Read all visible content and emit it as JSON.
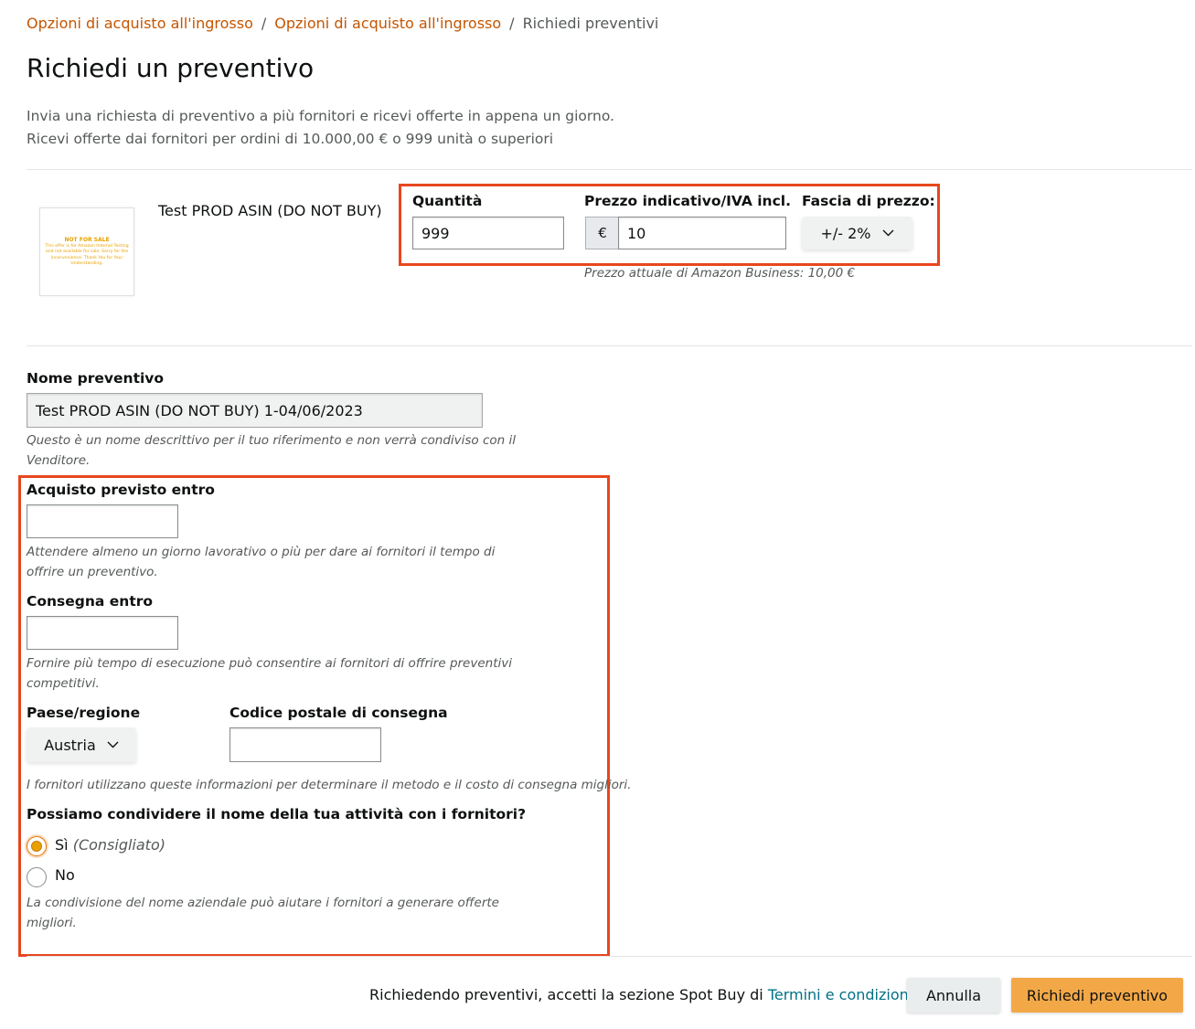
{
  "breadcrumb": {
    "item1": "Opzioni di acquisto all'ingrosso",
    "item2": "Opzioni di acquisto all'ingrosso",
    "current": "Richiedi preventivi",
    "separator": "/"
  },
  "page": {
    "title": "Richiedi un preventivo",
    "intro_line1": "Invia una richiesta di preventivo a più fornitori e ricevi offerte in appena un giorno.",
    "intro_line2": "Ricevi offerte dai fornitori per ordini di 10.000,00 € o 999 unità o superiori"
  },
  "product": {
    "name": "Test PROD ASIN (DO NOT BUY)",
    "thumbnail_title": "NOT FOR SALE",
    "thumbnail_text": "This offer is for Amazon Internal Testing and not available for sale. Sorry for the inconvenience. Thank You for Your Understanding."
  },
  "pricing": {
    "quantity_label": "Quantità",
    "quantity_value": "999",
    "price_label": "Prezzo indicativo/IVA incl.",
    "currency_symbol": "€",
    "price_value": "10",
    "range_label": "Fascia di prezzo:",
    "range_value": "+/- 2%",
    "current_price_note": "Prezzo attuale di Amazon Business: 10,00 €"
  },
  "quote_name": {
    "label": "Nome preventivo",
    "value": "Test PROD ASIN (DO NOT BUY) 1-04/06/2023",
    "hint_line1": "Questo è un nome descrittivo per il tuo riferimento e non verrà condiviso con il",
    "hint_line2": "Venditore."
  },
  "purchase_by": {
    "label": "Acquisto previsto entro",
    "value": "",
    "hint_line1": "Attendere almeno un giorno lavorativo o più per dare ai fornitori il tempo di",
    "hint_line2": "offrire un preventivo."
  },
  "delivery_by": {
    "label": "Consegna entro",
    "value": "",
    "hint_line1": "Fornire più tempo di esecuzione può consentire ai fornitori di offrire preventivi",
    "hint_line2": "competitivi."
  },
  "country": {
    "label": "Paese/regione",
    "value": "Austria"
  },
  "postal_code": {
    "label": "Codice postale di consegna",
    "value": ""
  },
  "shipping_hint": "I fornitori utilizzano queste informazioni per determinare il metodo e il costo di consegna migliori.",
  "share_business": {
    "question": "Possiamo condividere il nome della tua attività con i fornitori?",
    "option_yes": "Sì",
    "option_yes_note": "(Consigliato)",
    "option_no": "No",
    "selected": "yes",
    "hint_line1": "La condivisione del nome aziendale può aiutare i fornitori a generare offerte",
    "hint_line2": "migliori."
  },
  "footer": {
    "terms_prefix": "Richiedendo preventivi, accetti la sezione Spot Buy di",
    "terms_link": "Termini e condizioni",
    "cancel_label": "Annulla",
    "submit_label": "Richiedi preventivo"
  },
  "colors": {
    "highlight_box": "#e8461e",
    "breadcrumb_link": "#c45500",
    "link": "#007185",
    "primary_button": "#f3a847"
  }
}
